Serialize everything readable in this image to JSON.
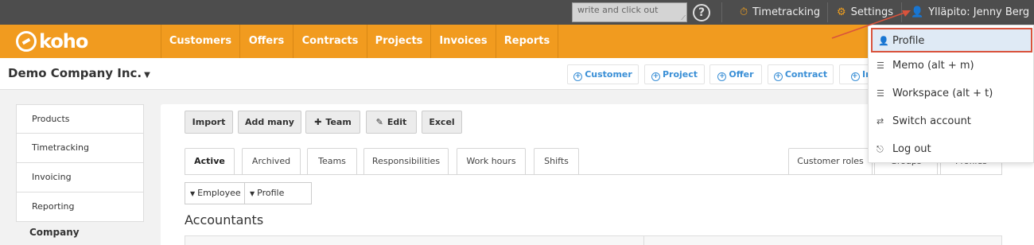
{
  "topbar": {
    "quick_placeholder": "write and click out",
    "help_icon": "?",
    "timetracking_label": "Timetracking",
    "settings_label": "Settings",
    "user_label": "Ylläpito: Jenny Berg"
  },
  "logo": {
    "text": "koho"
  },
  "nav": {
    "items": [
      "Customers",
      "Offers",
      "Contracts",
      "Projects",
      "Invoices",
      "Reports"
    ]
  },
  "company": {
    "name": "Demo Company Inc.",
    "quick_add": [
      "Customer",
      "Project",
      "Offer",
      "Contract",
      "In"
    ]
  },
  "sidebar": {
    "items": [
      "Products",
      "Timetracking",
      "Invoicing",
      "Reporting"
    ],
    "section_title": "Company"
  },
  "toolbar": {
    "import": "Import",
    "add_many": "Add many",
    "team": "Team",
    "edit": "Edit",
    "excel": "Excel"
  },
  "tabs": {
    "items": [
      "Active",
      "Archived",
      "Teams",
      "Responsibilities",
      "Work hours",
      "Shifts"
    ],
    "right_items": [
      "Customer roles",
      "Groups",
      "Profiles"
    ],
    "active_index": 0
  },
  "filters": {
    "employee": "Employee",
    "profile": "Profile"
  },
  "main": {
    "section_title": "Accountants"
  },
  "dropdown": {
    "items": [
      "Profile",
      "Memo (alt + m)",
      "Workspace (alt + t)",
      "Switch account",
      "Log out"
    ],
    "highlighted_index": 0
  },
  "colors": {
    "nav_orange": "#f19b1f",
    "topbar_dark": "#4d4d4d",
    "link_blue": "#3a8fd6",
    "highlight_red": "#d9533c"
  }
}
